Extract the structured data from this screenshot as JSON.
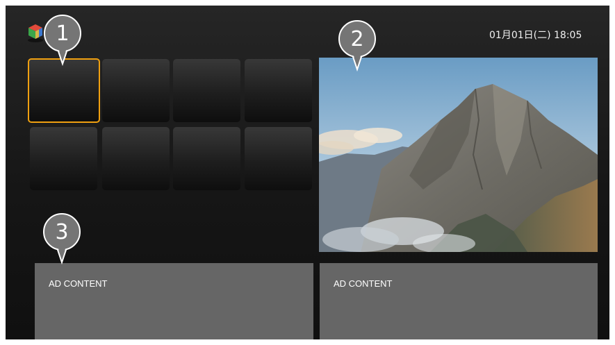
{
  "status_bar": {
    "datetime": "01月01日(二) 18:05",
    "logo_icon": "cube-logo-icon"
  },
  "app_grid": {
    "focused_index": 0,
    "focus_color": "#f0a010",
    "tile_count": 8
  },
  "featured": {
    "image_icon": "mountain-landscape-image"
  },
  "ads": [
    {
      "label": "AD CONTENT"
    },
    {
      "label": "AD CONTENT"
    }
  ],
  "callouts": [
    {
      "number": "1"
    },
    {
      "number": "2"
    },
    {
      "number": "3"
    }
  ],
  "colors": {
    "background": "#1a1a1a",
    "ad_background": "#666666",
    "callout": "#757575"
  }
}
